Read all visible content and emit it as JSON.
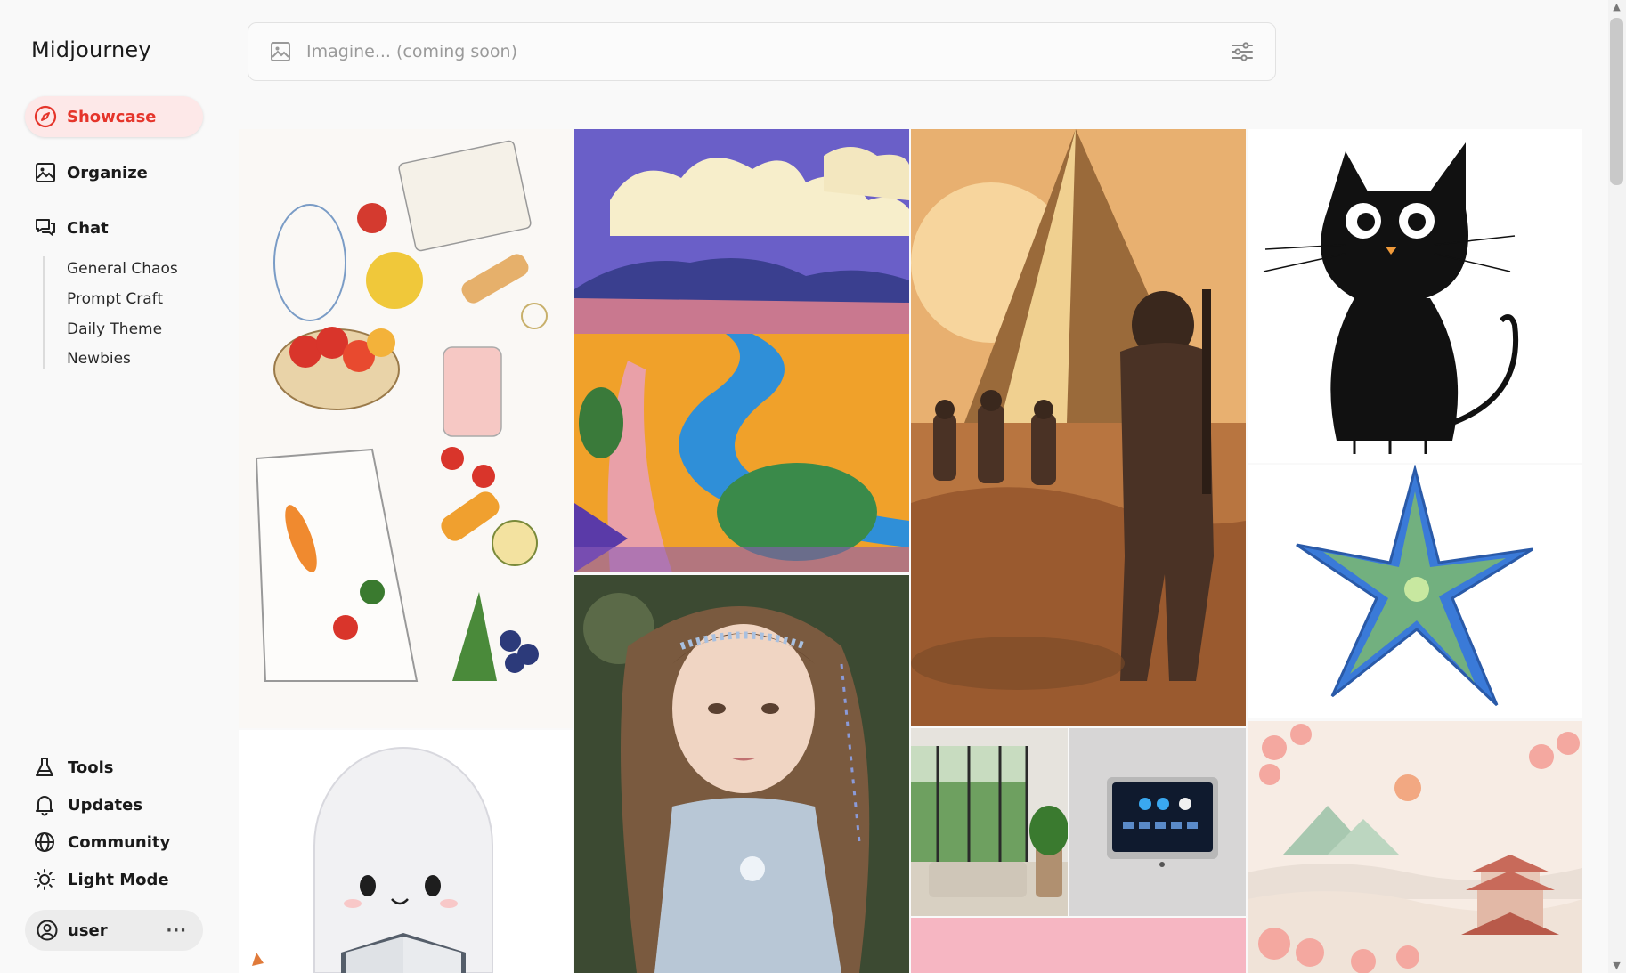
{
  "app": {
    "brand": "Midjourney"
  },
  "nav": {
    "showcase": "Showcase",
    "organize": "Organize",
    "chat": "Chat",
    "chat_channels": [
      "General Chaos",
      "Prompt Craft",
      "Daily Theme",
      "Newbies"
    ]
  },
  "bottom_nav": {
    "tools": "Tools",
    "updates": "Updates",
    "community": "Community",
    "light_mode": "Light Mode"
  },
  "user": {
    "name": "user",
    "menu": "···"
  },
  "imagine": {
    "placeholder": "Imagine... (coming soon)",
    "value": ""
  },
  "colors": {
    "accent": "#e5352b",
    "active_bg": "#fde8e8"
  },
  "gallery": {
    "tiles": [
      "grocery-sketch-image",
      "landscape-river-image",
      "pyramid-soldiers-image",
      "black-cat-sketch-image",
      "starfish-image",
      "fairy-girl-image",
      "modern-livingroom-image",
      "smart-panel-image",
      "paper-cherry-blossom-image",
      "ghost-reading-image",
      "pink-image"
    ]
  },
  "icons": {
    "showcase": "compass-icon",
    "organize": "image-icon",
    "chat": "chat-icon",
    "tools": "flask-icon",
    "updates": "bell-icon",
    "community": "globe-icon",
    "light_mode": "sun-icon",
    "user": "user-circle-icon",
    "imagine": "image-icon",
    "filter": "sliders-icon"
  }
}
